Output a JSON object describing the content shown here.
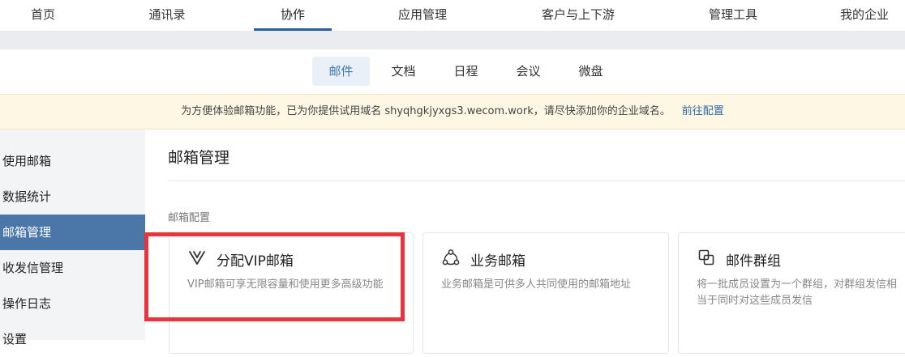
{
  "topnav": {
    "items": [
      "首页",
      "通讯录",
      "协作",
      "应用管理",
      "客户与上下游",
      "管理工具",
      "我的企业"
    ],
    "active_index": 2
  },
  "subtabs": {
    "items": [
      "邮件",
      "文档",
      "日程",
      "会议",
      "微盘"
    ],
    "active_index": 0
  },
  "notice": {
    "text": "为方便体验邮箱功能，已为你提供试用域名 shyqhgkjyxgs3.wecom.work，请尽快添加你的企业域名。",
    "link": "前往配置"
  },
  "sidebar": {
    "items": [
      "使用邮箱",
      "数据统计",
      "邮箱管理",
      "收发信管理",
      "操作日志",
      "设置"
    ],
    "active_index": 2
  },
  "main": {
    "title": "邮箱管理",
    "section_label": "邮箱配置",
    "cards": [
      {
        "icon": "vip-v-icon",
        "title": "分配VIP邮箱",
        "desc": "VIP邮箱可享无限容量和使用更多高级功能"
      },
      {
        "icon": "share-nodes-icon",
        "title": "业务邮箱",
        "desc": "业务邮箱是可供多人共同使用的邮箱地址"
      },
      {
        "icon": "group-copy-icon",
        "title": "邮件群组",
        "desc": "将一批成员设置为一个群组，对群组发信相当于同时对这些成员发信"
      }
    ]
  },
  "colors": {
    "accent": "#2a5f9e",
    "sidebar_active": "#4a76a8",
    "link": "#2f6aa8",
    "notice_bg": "#fdf7e4",
    "highlight": "#e8343b"
  }
}
